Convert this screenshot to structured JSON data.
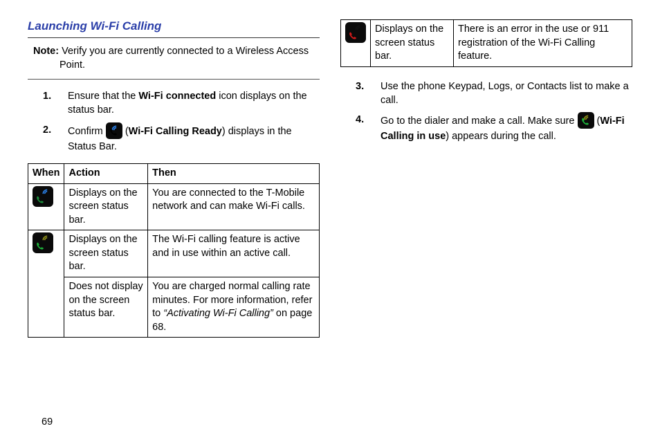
{
  "section_title": "Launching Wi-Fi Calling",
  "note_label": "Note:",
  "note_text_line1": "Verify you are currently connected to a Wireless Access",
  "note_text_line2": "Point.",
  "steps_left": [
    {
      "num": "1.",
      "html_parts": [
        "Ensure that the ",
        {
          "b": "Wi-Fi connected"
        },
        " icon displays on the status bar."
      ]
    },
    {
      "num": "2.",
      "html_parts": [
        "Confirm ",
        {
          "icon": "wifi-calling-ready-icon",
          "color_phone": "#000",
          "color_wave": "#2a7de1",
          "bg": "#0a0a0a"
        },
        " (",
        {
          "b": "Wi-Fi Calling Ready"
        },
        ") displays in the Status Bar."
      ]
    }
  ],
  "table_headers": {
    "when": "When",
    "action": "Action",
    "then": "Then"
  },
  "table_rows": [
    {
      "icon": {
        "name": "wifi-calling-ready-icon",
        "phone": "#1a8e3a",
        "wave": "#2a7de1"
      },
      "action": "Displays on the screen status bar.",
      "then": "You are connected to the T-Mobile network and can make Wi-Fi calls."
    },
    {
      "icon": {
        "name": "wifi-calling-inuse-icon",
        "phone": "#1db03a",
        "wave": "#8a8a1a"
      },
      "action": "Displays on the screen status bar.",
      "then": "The Wi-Fi calling feature is active and in use within an active call."
    },
    {
      "icon": null,
      "action": "Does not display on the screen status bar.",
      "then_parts": [
        "You are charged normal calling rate minutes. For more information, refer to ",
        {
          "i": "“Activating Wi-Fi Calling”"
        },
        "  on page 68."
      ]
    }
  ],
  "right_table_row": {
    "icon": {
      "name": "wifi-calling-error-icon",
      "phone": "#d11a1a",
      "wave": "#111"
    },
    "action": "Displays on the screen status bar.",
    "then": "There is an error in the use or 911 registration of the Wi-Fi Calling feature."
  },
  "steps_right": [
    {
      "num": "3.",
      "text": "Use the phone Keypad, Logs, or Contacts list to make a call."
    },
    {
      "num": "4.",
      "html_parts": [
        "Go to the dialer and make a call. Make sure ",
        {
          "icon": "wifi-calling-inuse-icon",
          "color_phone": "#1db03a",
          "color_wave": "#8a8a1a",
          "bg": "#0a0a0a"
        },
        " (",
        {
          "b": "Wi-Fi Calling in use"
        },
        ") appears during the call."
      ]
    }
  ],
  "page_number": "69"
}
